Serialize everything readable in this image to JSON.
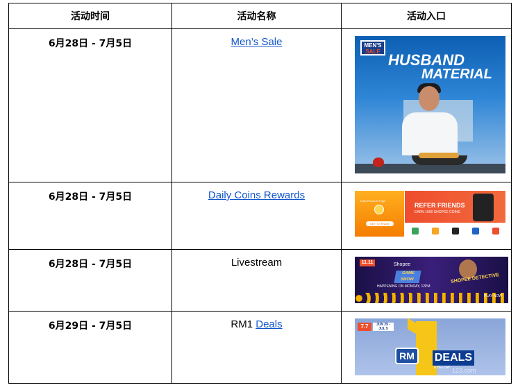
{
  "table": {
    "headers": [
      "活动时间",
      "活动名称",
      "活动入口"
    ],
    "rows": [
      {
        "date": "6月28日 - 7月5日",
        "name_prefix": "",
        "name": "Men’s Sale",
        "name_is_link": true,
        "banner": {
          "logo_line1": "MEN'S",
          "logo_line2": "SALE",
          "title_line1": "HUSBAND",
          "title_line2": "MATERIAL"
        }
      },
      {
        "date": "6月28日 - 7月5日",
        "name_prefix": "",
        "name": "Daily Coins Rewards",
        "name_is_link": true,
        "banner": {
          "caption": "Daily Rewards Page",
          "button": "GET TO KNOW",
          "headline": "REFER FRIENDS",
          "sub": "EARN 1000 SHOPEE COINS"
        }
      },
      {
        "date": "6月28日 - 7月5日",
        "name_prefix": "",
        "name": "Livestream",
        "name_is_link": false,
        "banner": {
          "date_tag": "11.11",
          "brand": "Shopee",
          "show": "GAME SHOW",
          "schedule": "HAPPENING ON MONDAY, 12PM",
          "detective": "SHOPEE DETECTIVE",
          "play": "PLAY NOW"
        }
      },
      {
        "date": "6月29日 - 7月5日",
        "name_prefix": "RM1 ",
        "name": "Deals",
        "name_is_link": true,
        "banner": {
          "tag": "7.7",
          "date_tag": "JUN 29 - JUL 5",
          "rm": "RM",
          "deals": "DEALS",
          "below": "& BELOW",
          "watermark": "123.com"
        }
      }
    ]
  }
}
